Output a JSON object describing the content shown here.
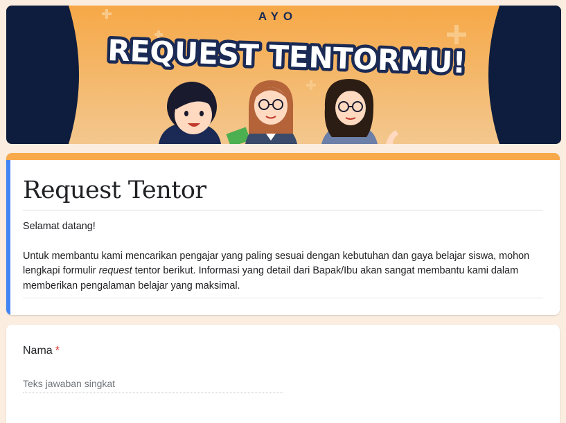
{
  "banner": {
    "kicker": "AYO",
    "headline": "REQUEST TENTORMU!",
    "colors": {
      "orange": "#f8a94a",
      "navy": "#0e1d3d"
    }
  },
  "form": {
    "title": "Request Tentor",
    "description": {
      "greeting": "Selamat datang!",
      "body_before": "Untuk membantu kami mencarikan pengajar yang paling sesuai dengan kebutuhan dan gaya belajar siswa, mohon lengkapi formulir ",
      "body_italic": "request",
      "body_after": " tentor berikut. Informasi yang detail dari Bapak/Ibu akan sangat membantu kami dalam memberikan pengalaman belajar yang maksimal."
    },
    "accent_color": "#4285f4"
  },
  "questions": [
    {
      "label": "Nama",
      "required_mark": "*",
      "placeholder": "Teks jawaban singkat"
    }
  ]
}
